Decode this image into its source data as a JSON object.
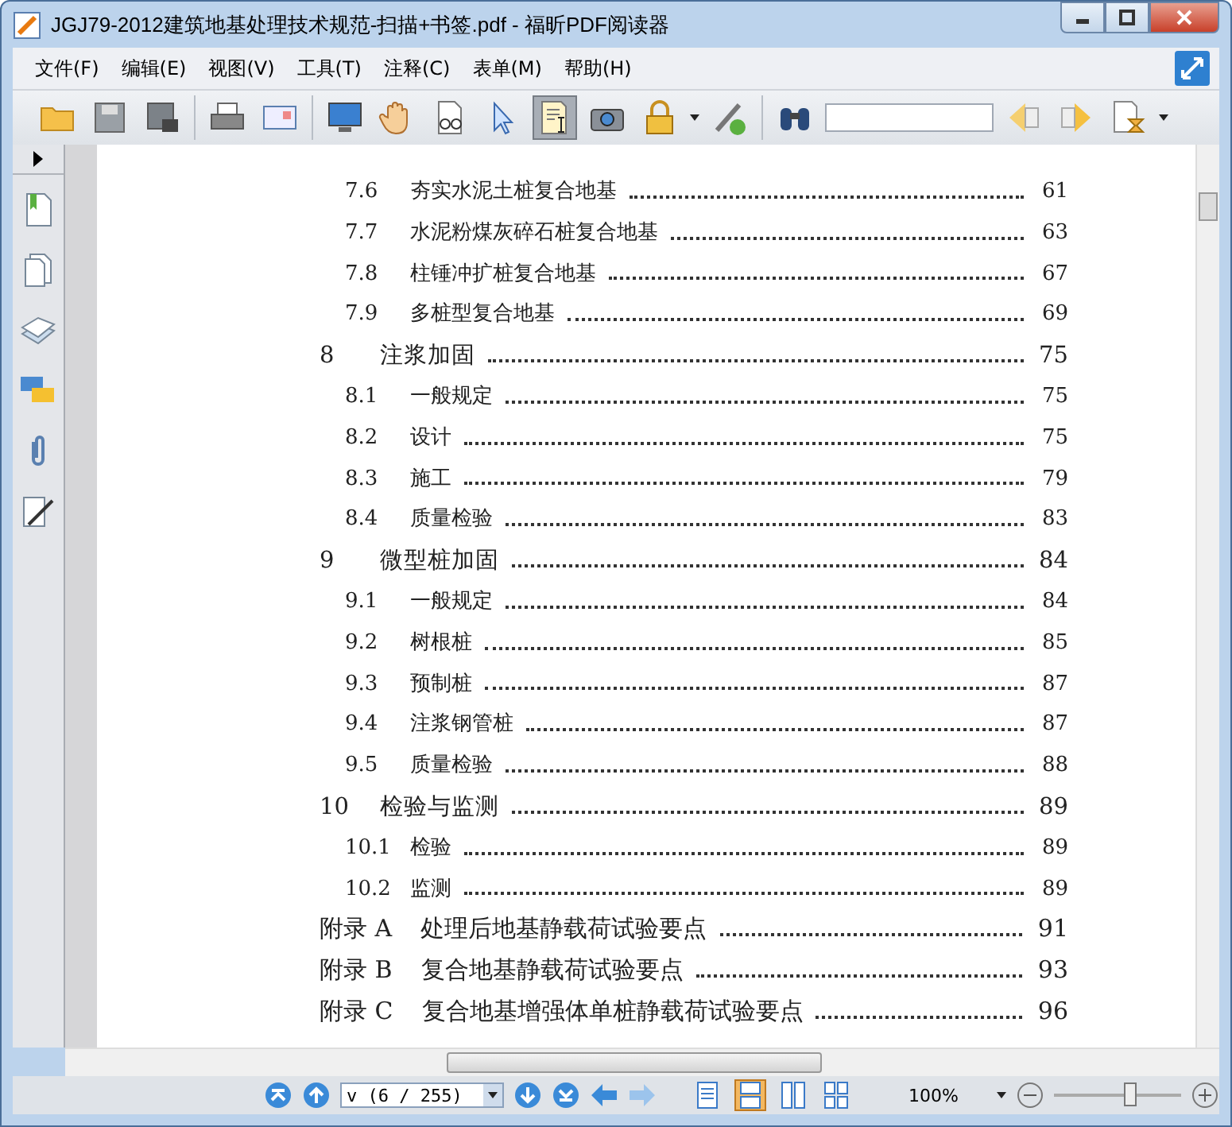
{
  "window": {
    "title": "JGJ79-2012建筑地基处理技术规范-扫描+书签.pdf - 福昕PDF阅读器"
  },
  "menu": [
    "文件(F)",
    "编辑(E)",
    "视图(V)",
    "工具(T)",
    "注释(C)",
    "表单(M)",
    "帮助(H)"
  ],
  "toolbar": [
    {
      "kind": "open",
      "selected": false
    },
    {
      "kind": "save",
      "selected": false
    },
    {
      "kind": "saveas",
      "selected": false
    },
    {
      "kind": "sep"
    },
    {
      "kind": "print",
      "selected": false
    },
    {
      "kind": "mail",
      "selected": false
    },
    {
      "kind": "sep"
    },
    {
      "kind": "monitor",
      "selected": false
    },
    {
      "kind": "hand",
      "selected": false
    },
    {
      "kind": "zoomdoc",
      "selected": false
    },
    {
      "kind": "pointer",
      "selected": false
    },
    {
      "kind": "textselect",
      "selected": true
    },
    {
      "kind": "camera",
      "selected": false
    },
    {
      "kind": "lock",
      "selected": false
    },
    {
      "kind": "caret"
    },
    {
      "kind": "pen",
      "selected": false
    },
    {
      "kind": "sep"
    },
    {
      "kind": "binoculars",
      "selected": false
    },
    {
      "kind": "search"
    },
    {
      "kind": "prev",
      "selected": false
    },
    {
      "kind": "next",
      "selected": false
    },
    {
      "kind": "hourglass",
      "selected": false
    },
    {
      "kind": "caret"
    }
  ],
  "sidebar": [
    {
      "kind": "bookmark"
    },
    {
      "kind": "pages"
    },
    {
      "kind": "layers"
    },
    {
      "kind": "comments"
    },
    {
      "kind": "clip"
    },
    {
      "kind": "sign"
    }
  ],
  "toc": [
    {
      "kind": "sub",
      "number": "7.6",
      "title": "夯实水泥土桩复合地基",
      "page": "61"
    },
    {
      "kind": "sub",
      "number": "7.7",
      "title": "水泥粉煤灰碎石桩复合地基",
      "page": "63"
    },
    {
      "kind": "sub",
      "number": "7.8",
      "title": "柱锤冲扩桩复合地基",
      "page": "67"
    },
    {
      "kind": "sub",
      "number": "7.9",
      "title": "多桩型复合地基",
      "page": "69"
    },
    {
      "kind": "chapter",
      "number": "8",
      "title": "注浆加固",
      "page": "75"
    },
    {
      "kind": "sub",
      "number": "8.1",
      "title": "一般规定",
      "page": "75"
    },
    {
      "kind": "sub",
      "number": "8.2",
      "title": "设计",
      "page": "75"
    },
    {
      "kind": "sub",
      "number": "8.3",
      "title": "施工",
      "page": "79"
    },
    {
      "kind": "sub",
      "number": "8.4",
      "title": "质量检验",
      "page": "83"
    },
    {
      "kind": "chapter",
      "number": "9",
      "title": "微型桩加固",
      "page": "84"
    },
    {
      "kind": "sub",
      "number": "9.1",
      "title": "一般规定",
      "page": "84"
    },
    {
      "kind": "sub",
      "number": "9.2",
      "title": "树根桩",
      "page": "85"
    },
    {
      "kind": "sub",
      "number": "9.3",
      "title": "预制桩",
      "page": "87"
    },
    {
      "kind": "sub",
      "number": "9.4",
      "title": "注浆钢管桩",
      "page": "87"
    },
    {
      "kind": "sub",
      "number": "9.5",
      "title": "质量检验",
      "page": "88"
    },
    {
      "kind": "chapter",
      "number": "10",
      "title": "检验与监测",
      "page": "89"
    },
    {
      "kind": "sub",
      "number": "10.1",
      "title": "检验",
      "page": "89"
    },
    {
      "kind": "sub",
      "number": "10.2",
      "title": "监测",
      "page": "89"
    },
    {
      "kind": "appendix",
      "number": "附录 A",
      "title": "处理后地基静载荷试验要点",
      "page": "91"
    },
    {
      "kind": "appendix",
      "number": "附录 B",
      "title": "复合地基静载荷试验要点",
      "page": "93"
    },
    {
      "kind": "appendix",
      "number": "附录 C",
      "title": "复合地基增强体单桩静载荷试验要点",
      "page": "96"
    }
  ],
  "status": {
    "page_field": "v (6 / 255)",
    "zoom": "100%",
    "zoom_slider": {
      "level": 0.6
    },
    "view_modes": [
      {
        "kind": "single",
        "selected": false
      },
      {
        "kind": "continuous",
        "selected": true
      },
      {
        "kind": "facing",
        "selected": false
      },
      {
        "kind": "cover",
        "selected": false
      }
    ]
  }
}
